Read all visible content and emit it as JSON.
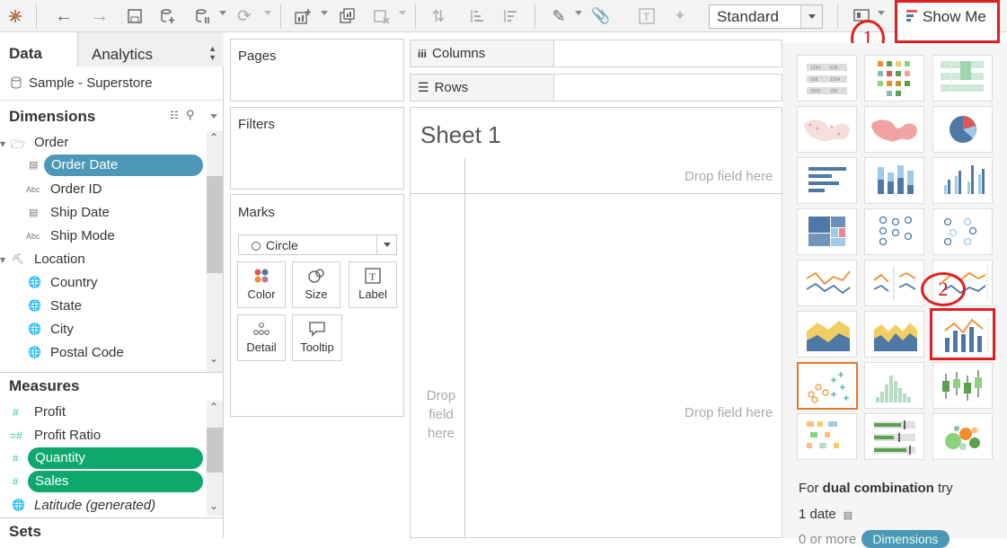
{
  "toolbar": {
    "standard": "Standard",
    "show_me": "Show Me"
  },
  "annotations": {
    "one": "1",
    "two": "2"
  },
  "data_pane": {
    "tab_data": "Data",
    "tab_analytics": "Analytics",
    "datasource": "Sample - Superstore",
    "dimensions_title": "Dimensions",
    "dimensions": [
      {
        "label": "Order",
        "type": "folder"
      },
      {
        "label": "Order Date",
        "type": "date"
      },
      {
        "label": "Order ID",
        "type": "abc"
      },
      {
        "label": "Ship Date",
        "type": "date"
      },
      {
        "label": "Ship Mode",
        "type": "abc"
      },
      {
        "label": "Location",
        "type": "hierarchy"
      },
      {
        "label": "Country",
        "type": "geo"
      },
      {
        "label": "State",
        "type": "geo"
      },
      {
        "label": "City",
        "type": "geo"
      },
      {
        "label": "Postal Code",
        "type": "geo"
      }
    ],
    "measures_title": "Measures",
    "measures": [
      {
        "label": "Profit"
      },
      {
        "label": "Profit Ratio"
      },
      {
        "label": "Quantity"
      },
      {
        "label": "Sales"
      },
      {
        "label": "Latitude (generated)"
      }
    ],
    "sets_title": "Sets"
  },
  "shelves": {
    "pages": "Pages",
    "filters": "Filters",
    "marks": "Marks",
    "mark_type": "Circle",
    "mark_buttons": [
      "Color",
      "Size",
      "Label",
      "Detail",
      "Tooltip"
    ],
    "columns": "Columns",
    "rows": "Rows"
  },
  "sheet": {
    "title": "Sheet 1",
    "drop_top": "Drop field here",
    "drop_left": [
      "Drop",
      "field",
      "here"
    ],
    "drop_center": "Drop field here"
  },
  "show_me": {
    "hint_prefix": "For ",
    "hint_bold": "dual combination",
    "hint_suffix": " try",
    "req1": "1 date",
    "req2": "0 or more",
    "req2_pill": "Dimensions"
  },
  "colors": {
    "accent_blue": "#4e98b7",
    "measure_green": "#0ea86c",
    "highlight_red": "#e02020"
  }
}
